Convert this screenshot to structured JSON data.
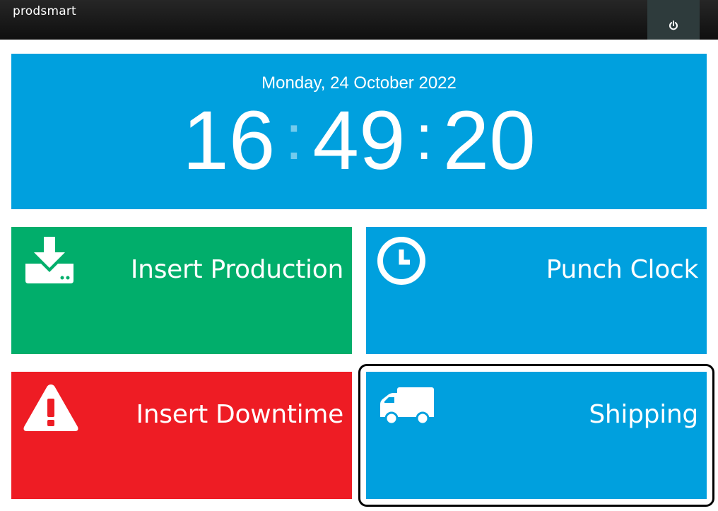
{
  "header": {
    "brand": "prodsmart",
    "power_icon": "power-icon"
  },
  "clock": {
    "date": "Monday, 24 October 2022",
    "hours": "16",
    "minutes": "49",
    "seconds": "20",
    "separator": ":"
  },
  "tiles": [
    {
      "label": "Insert Production",
      "icon": "download-drive-icon",
      "color": "#01ae6b"
    },
    {
      "label": "Punch Clock",
      "icon": "clock-icon",
      "color": "#00a0de"
    },
    {
      "label": "Insert Downtime",
      "icon": "warning-icon",
      "color": "#ee1c24"
    },
    {
      "label": "Shipping",
      "icon": "truck-icon",
      "color": "#00a0de"
    }
  ],
  "colors": {
    "topbar": "#1a1a1a",
    "power_button": "#2e3b3c",
    "accent_blue": "#00a0de",
    "green": "#01ae6b",
    "red": "#ee1c24"
  }
}
